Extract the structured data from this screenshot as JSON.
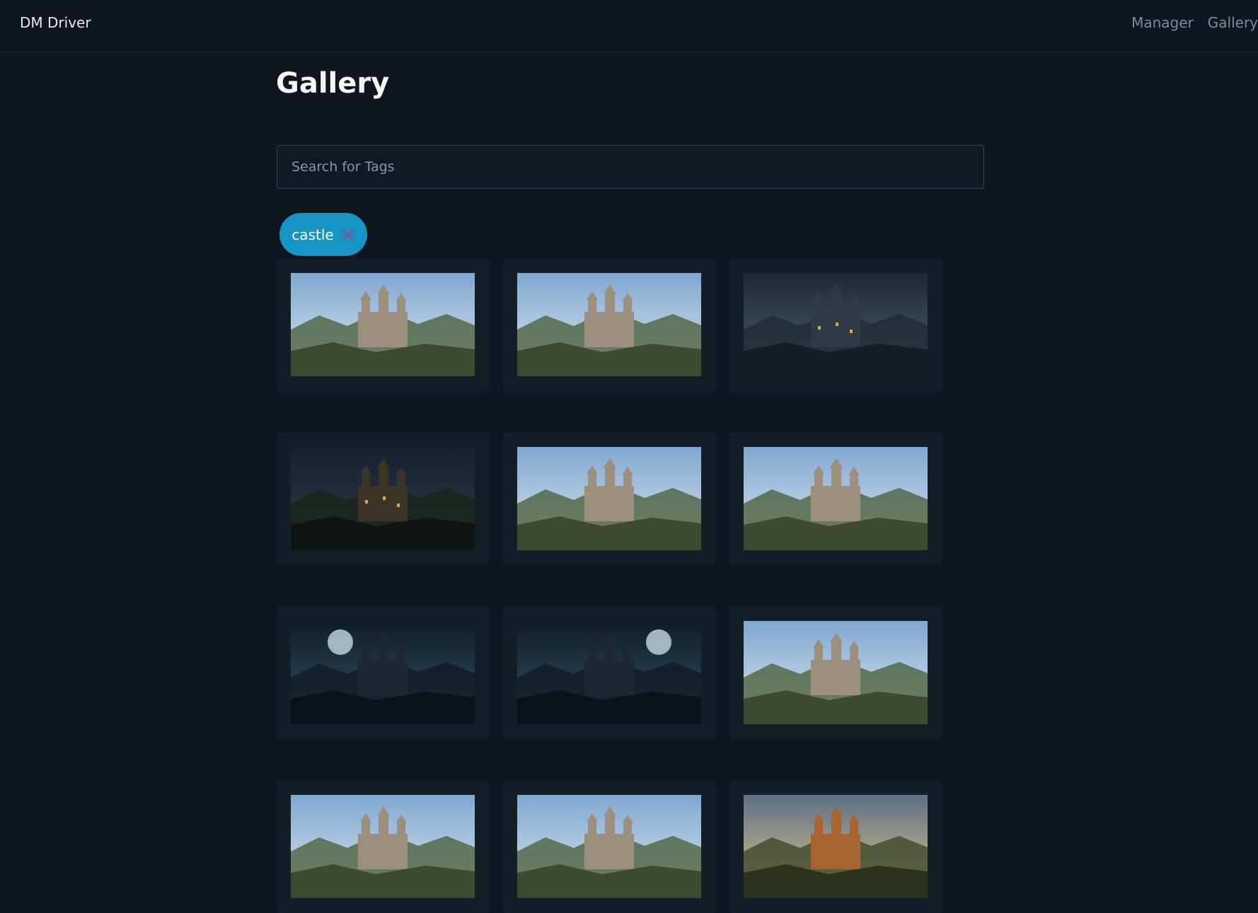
{
  "app": {
    "title": "DM Driver"
  },
  "nav": {
    "items": [
      {
        "label": "Manager"
      },
      {
        "label": "Gallery"
      }
    ]
  },
  "page": {
    "title": "Gallery"
  },
  "search": {
    "placeholder": "Search for Tags",
    "value": ""
  },
  "tags": [
    {
      "label": "castle",
      "remove_icon": "close-icon"
    }
  ],
  "colors": {
    "background": "#0f161d",
    "card": "#141e27",
    "chip": "#1595c3",
    "chip_remove": "#8a4e9b",
    "nav_link": "#7f8a96"
  },
  "gallery": {
    "items": [
      {
        "theme": "day"
      },
      {
        "theme": "day"
      },
      {
        "theme": "dusk"
      },
      {
        "theme": "night"
      },
      {
        "theme": "day"
      },
      {
        "theme": "day"
      },
      {
        "theme": "moon"
      },
      {
        "theme": "moon"
      },
      {
        "theme": "day"
      },
      {
        "theme": "day"
      },
      {
        "theme": "day"
      },
      {
        "theme": "sunset"
      }
    ]
  }
}
